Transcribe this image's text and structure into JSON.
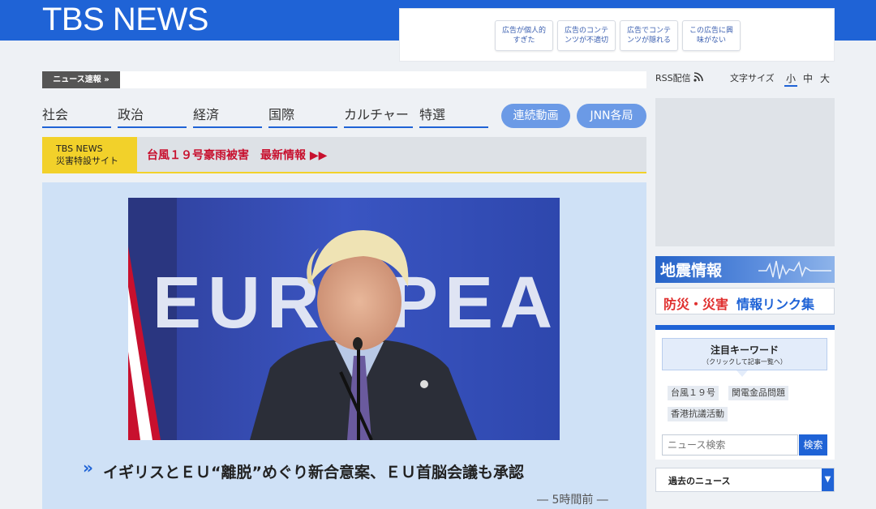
{
  "header": {
    "logo": "TBS NEWS",
    "ad_buttons": [
      "広告が個人的すぎた",
      "広告のコンテンツが不適切",
      "広告でコンテンツが隠れる",
      "この広告に興味がない"
    ]
  },
  "ticker": {
    "label": "ニュース速報 »"
  },
  "nav": {
    "tabs": [
      "社会",
      "政治",
      "経済",
      "国際",
      "カルチャー",
      "特選"
    ],
    "pills": [
      "連続動画",
      "JNN各局"
    ]
  },
  "disaster": {
    "label_line1": "TBS NEWS",
    "label_line2": "災害特設サイト",
    "link": "台風１９号豪雨被害　最新情報 ▶▶"
  },
  "feature": {
    "photo_text": "EUROPEAN",
    "headline_chevron": "»",
    "headline": "イギリスとＥＵ“離脱”めぐり新合意案、ＥＵ首脳会議も承認",
    "time_ago": "― 5時間前 ―"
  },
  "sidebar": {
    "rss": "RSS配信",
    "font_size_label": "文字サイズ",
    "font_sizes": [
      "小",
      "中",
      "大"
    ],
    "quake": "地震情報",
    "bosai_part1": "防災・災害",
    "bosai_part2": "情報リンク集",
    "keywords_title": "注目キーワード",
    "keywords_sub": "（クリックして記事一覧へ）",
    "keywords": [
      "台風１９号",
      "関電金品問題",
      "香港抗議活動"
    ],
    "search_placeholder": "ニュース検索",
    "search_button": "検索",
    "past_news": "過去のニュース",
    "past_arrow": "▼"
  },
  "colors": {
    "brand": "#1f63d6",
    "alert": "#c8102e",
    "disaster_yellow": "#f2d12a"
  }
}
